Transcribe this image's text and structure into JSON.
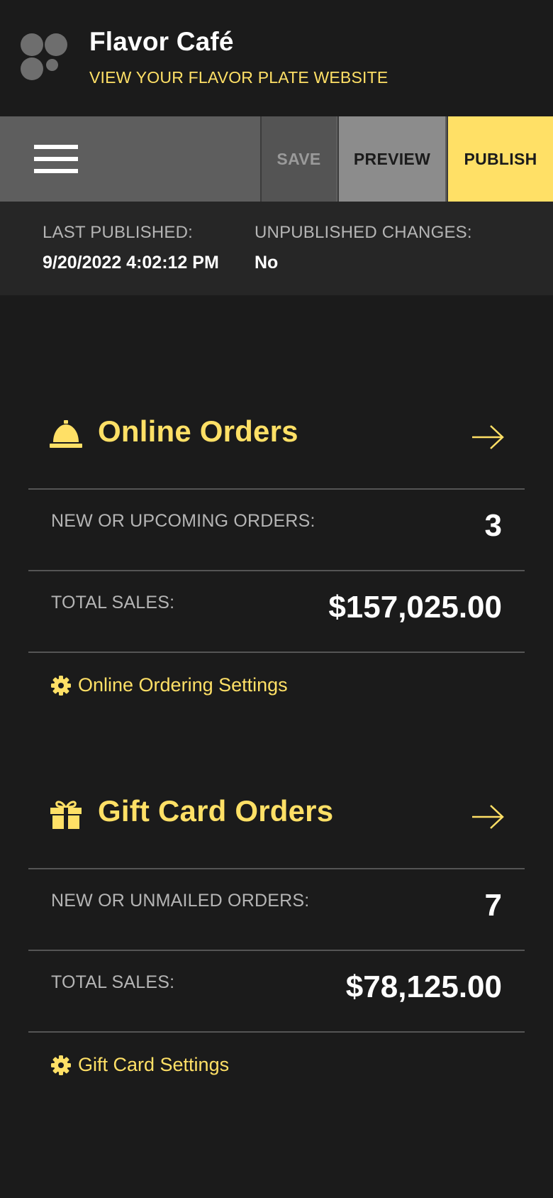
{
  "header": {
    "app_title": "Flavor Café",
    "site_link": "VIEW YOUR FLAVOR PLATE WEBSITE"
  },
  "toolbar": {
    "menu_icon": "hamburger-menu-icon",
    "save_label": "SAVE",
    "preview_label": "PREVIEW",
    "publish_label": "PUBLISH"
  },
  "publish_status": {
    "last_published_label": "LAST PUBLISHED:",
    "last_published_value": "9/20/2022 4:02:12 PM",
    "unpublished_label": "UNPUBLISHED CHANGES:",
    "unpublished_value": "No"
  },
  "online_orders": {
    "icon": "service-bell-icon",
    "title": "Online Orders",
    "arrow_icon": "arrow-right-icon",
    "new_orders_label": "NEW OR UPCOMING ORDERS:",
    "new_orders_value": "3",
    "total_sales_label": "TOTAL SALES:",
    "total_sales_value": "$157,025.00",
    "settings_icon": "gear-icon",
    "settings_link": "Online Ordering Settings"
  },
  "gift_card_orders": {
    "icon": "gift-icon",
    "title": "Gift Card Orders",
    "arrow_icon": "arrow-right-icon",
    "new_orders_label": "NEW OR UNMAILED ORDERS:",
    "new_orders_value": "7",
    "total_sales_label": "TOTAL SALES:",
    "total_sales_value": "$78,125.00",
    "settings_icon": "gear-icon",
    "settings_link": "Gift Card Settings"
  },
  "colors": {
    "background": "#1b1b1b",
    "accent": "#ffe066",
    "toolbar": "#5e5e5e",
    "status_bar": "#262626",
    "divider": "#555555"
  }
}
